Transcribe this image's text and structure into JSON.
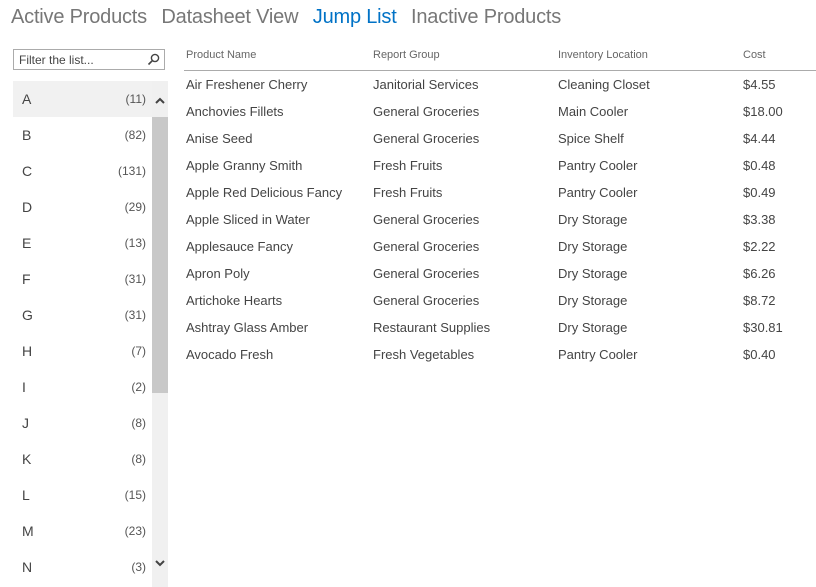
{
  "views": [
    {
      "label": "Active Products",
      "active": false
    },
    {
      "label": "Datasheet View",
      "active": false
    },
    {
      "label": "Jump List",
      "active": true
    },
    {
      "label": "Inactive Products",
      "active": false
    }
  ],
  "filter": {
    "placeholder": "Filter the list...",
    "icon": "search-icon"
  },
  "jump_list": [
    {
      "letter": "A",
      "count": "(11)",
      "selected": true
    },
    {
      "letter": "B",
      "count": "(82)"
    },
    {
      "letter": "C",
      "count": "(131)"
    },
    {
      "letter": "D",
      "count": "(29)"
    },
    {
      "letter": "E",
      "count": "(13)"
    },
    {
      "letter": "F",
      "count": "(31)"
    },
    {
      "letter": "G",
      "count": "(31)"
    },
    {
      "letter": "H",
      "count": "(7)"
    },
    {
      "letter": "I",
      "count": "(2)"
    },
    {
      "letter": "J",
      "count": "(8)"
    },
    {
      "letter": "K",
      "count": "(8)"
    },
    {
      "letter": "L",
      "count": "(15)"
    },
    {
      "letter": "M",
      "count": "(23)"
    },
    {
      "letter": "N",
      "count": "(3)"
    }
  ],
  "table": {
    "columns": [
      "Product Name",
      "Report Group",
      "Inventory Location",
      "Cost"
    ],
    "rows": [
      [
        "Air Freshener Cherry",
        "Janitorial Services",
        "Cleaning Closet",
        "$4.55"
      ],
      [
        "Anchovies Fillets",
        "General Groceries",
        "Main Cooler",
        "$18.00"
      ],
      [
        "Anise Seed",
        "General Groceries",
        "Spice Shelf",
        "$4.44"
      ],
      [
        "Apple Granny Smith",
        "Fresh Fruits",
        "Pantry Cooler",
        "$0.48"
      ],
      [
        "Apple Red Delicious Fancy",
        "Fresh Fruits",
        "Pantry Cooler",
        "$0.49"
      ],
      [
        "Apple Sliced in Water",
        "General Groceries",
        "Dry Storage",
        "$3.38"
      ],
      [
        "Applesauce Fancy",
        "General Groceries",
        "Dry Storage",
        "$2.22"
      ],
      [
        "Apron Poly",
        "General Groceries",
        "Dry Storage",
        "$6.26"
      ],
      [
        "Artichoke Hearts",
        "General Groceries",
        "Dry Storage",
        "$8.72"
      ],
      [
        "Ashtray Glass Amber",
        "Restaurant Supplies",
        "Dry Storage",
        "$30.81"
      ],
      [
        "Avocado Fresh",
        "Fresh Vegetables",
        "Pantry Cooler",
        "$0.40"
      ]
    ]
  },
  "colors": {
    "accent": "#0072c6",
    "text": "#444444",
    "selected_bg": "#f1f1f1",
    "scroll_thumb": "#c8c8c8"
  }
}
